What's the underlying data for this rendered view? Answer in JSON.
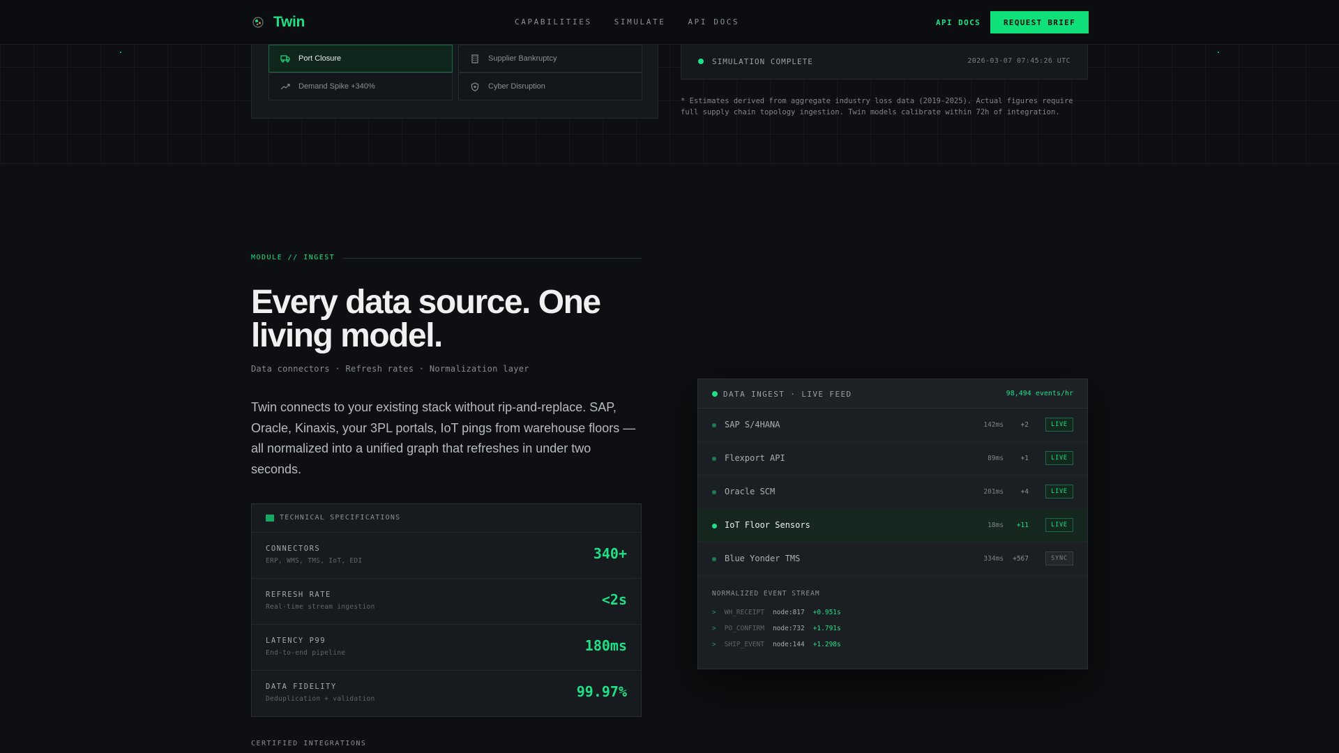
{
  "nav": {
    "brand": "Twin",
    "links": [
      "CAPABILITIES",
      "SIMULATE",
      "API DOCS"
    ],
    "api_docs": "API DOCS",
    "cta": "REQUEST BRIEF"
  },
  "scenarios": [
    {
      "label": "Port Closure",
      "icon": "truck-icon",
      "active": true
    },
    {
      "label": "Supplier Bankruptcy",
      "icon": "building-icon",
      "active": false
    },
    {
      "label": "Demand Spike +340%",
      "icon": "trending-up-icon",
      "active": false
    },
    {
      "label": "Cyber Disruption",
      "icon": "shield-icon",
      "active": false
    }
  ],
  "simulation": {
    "status": "SIMULATION COMPLETE",
    "timestamp": "2026-03-07 07:45:26 UTC",
    "footnote": "* Estimates derived from aggregate industry loss data (2019-2025). Actual figures require full supply chain topology ingestion. Twin models calibrate within 72h of integration."
  },
  "module": {
    "tag": "MODULE // INGEST",
    "headline": "Every data source. One living model.",
    "subline": "Data connectors · Refresh rates · Normalization layer",
    "description": "Twin connects to your existing stack without rip-and-replace. SAP, Oracle, Kinaxis, your 3PL portals, IoT pings from warehouse floors — all normalized into a unified graph that refreshes in under two seconds."
  },
  "specs": {
    "title": "TECHNICAL SPECIFICATIONS",
    "rows": [
      {
        "name": "CONNECTORS",
        "sub": "ERP, WMS, TMS, IoT, EDI",
        "value": "340+"
      },
      {
        "name": "REFRESH RATE",
        "sub": "Real-time stream ingestion",
        "value": "<2s"
      },
      {
        "name": "LATENCY P99",
        "sub": "End-to-end pipeline",
        "value": "180ms"
      },
      {
        "name": "DATA FIDELITY",
        "sub": "Deduplication + validation",
        "value": "99.97%"
      }
    ]
  },
  "certified": "CERTIFIED INTEGRATIONS",
  "feed": {
    "title": "DATA INGEST · LIVE FEED",
    "rate": "98,494 events/hr",
    "sources": [
      {
        "name": "SAP S/4HANA",
        "latency": "142ms",
        "delta": "+2",
        "status": "LIVE",
        "highlight": false
      },
      {
        "name": "Flexport API",
        "latency": "89ms",
        "delta": "+1",
        "status": "LIVE",
        "highlight": false
      },
      {
        "name": "Oracle SCM",
        "latency": "201ms",
        "delta": "+4",
        "status": "LIVE",
        "highlight": false
      },
      {
        "name": "IoT Floor Sensors",
        "latency": "18ms",
        "delta": "+11",
        "status": "LIVE",
        "highlight": true
      },
      {
        "name": "Blue Yonder TMS",
        "latency": "334ms",
        "delta": "+567",
        "status": "SYNC",
        "highlight": false
      }
    ],
    "stream_title": "NORMALIZED EVENT STREAM",
    "stream": [
      {
        "caret": ">",
        "type": "WH_RECEIPT",
        "node": "node:817",
        "time": "+0.951s"
      },
      {
        "caret": ">",
        "type": "PO_CONFIRM",
        "node": "node:732",
        "time": "+1.791s"
      },
      {
        "caret": ">",
        "type": "SHIP_EVENT",
        "node": "node:144",
        "time": "+1.298s"
      }
    ]
  },
  "colors": {
    "accent": "#1fe084",
    "background": "#0d0f12",
    "card": "#171a1e"
  }
}
